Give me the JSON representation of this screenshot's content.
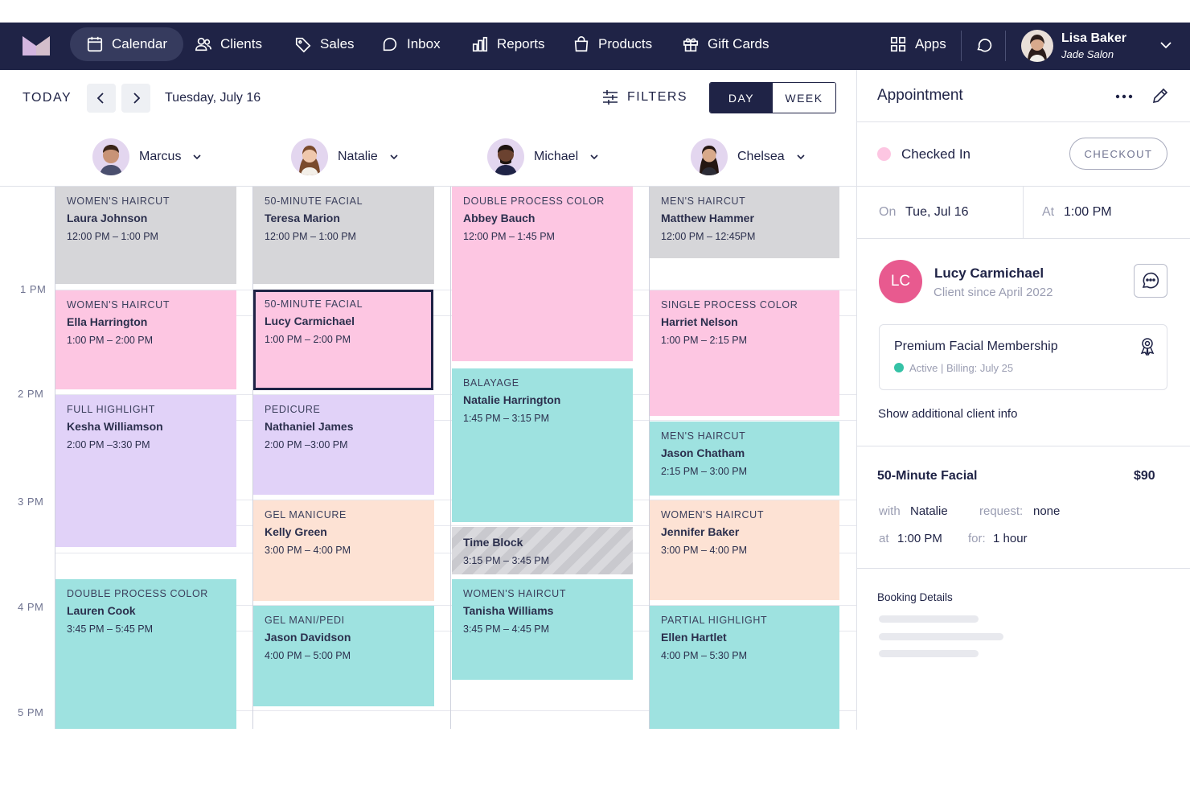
{
  "nav": {
    "items": [
      {
        "label": "Calendar",
        "icon": "calendar-icon"
      },
      {
        "label": "Clients",
        "icon": "clients-icon"
      },
      {
        "label": "Sales",
        "icon": "tag-icon"
      },
      {
        "label": "Inbox",
        "icon": "inbox-icon"
      },
      {
        "label": "Reports",
        "icon": "reports-icon"
      },
      {
        "label": "Products",
        "icon": "bag-icon"
      },
      {
        "label": "Gift Cards",
        "icon": "gift-icon"
      }
    ],
    "apps_label": "Apps",
    "user": {
      "name": "Lisa Baker",
      "salon": "Jade Salon"
    }
  },
  "toolbar": {
    "today_label": "TODAY",
    "date_label": "Tuesday, July 16",
    "filters_label": "FILTERS",
    "view_day": "DAY",
    "view_week": "WEEK"
  },
  "staff": [
    {
      "name": "Marcus"
    },
    {
      "name": "Natalie"
    },
    {
      "name": "Michael"
    },
    {
      "name": "Chelsea"
    }
  ],
  "time_labels": [
    "1 PM",
    "2 PM",
    "3 PM",
    "4 PM",
    "5 PM"
  ],
  "columns": [
    [
      {
        "service": "WOMEN'S HAIRCUT",
        "client": "Laura Johnson",
        "time": "12:00 PM – 1:00 PM",
        "color": "gray"
      },
      {
        "service": "WOMEN'S HAIRCUT",
        "client": "Ella Harrington",
        "time": "1:00 PM – 2:00 PM",
        "color": "pink"
      },
      {
        "service": "FULL HIGHLIGHT",
        "client": "Kesha Williamson",
        "time": "2:00 PM –3:30 PM",
        "color": "purple"
      },
      {
        "service": "DOUBLE PROCESS COLOR",
        "client": "Lauren Cook",
        "time": "3:45 PM – 5:45 PM",
        "color": "teal"
      }
    ],
    [
      {
        "service": "50-MINUTE FACIAL",
        "client": "Teresa Marion",
        "time": "12:00 PM – 1:00 PM",
        "color": "gray"
      },
      {
        "service": "50-MINUTE FACIAL",
        "client": "Lucy Carmichael",
        "time": "1:00 PM – 2:00 PM",
        "color": "pink",
        "selected": true
      },
      {
        "service": "PEDICURE",
        "client": "Nathaniel James",
        "time": "2:00 PM –3:00 PM",
        "color": "purple"
      },
      {
        "service": "GEL MANICURE",
        "client": "Kelly Green",
        "time": "3:00 PM – 4:00 PM",
        "color": "peach"
      },
      {
        "service": "GEL MANI/PEDI",
        "client": "Jason Davidson",
        "time": "4:00 PM – 5:00 PM",
        "color": "teal"
      }
    ],
    [
      {
        "service": "DOUBLE PROCESS COLOR",
        "client": "Abbey Bauch",
        "time": "12:00 PM – 1:45 PM",
        "color": "pink"
      },
      {
        "service": "BALAYAGE",
        "client": "Natalie Harrington",
        "time": "1:45 PM – 3:15 PM",
        "color": "teal"
      },
      {
        "service": "",
        "client": "Time Block",
        "time": "3:15 PM – 3:45 PM",
        "color": "block"
      },
      {
        "service": "WOMEN'S HAIRCUT",
        "client": "Tanisha Williams",
        "time": "3:45 PM – 4:45 PM",
        "color": "teal"
      }
    ],
    [
      {
        "service": "MEN'S HAIRCUT",
        "client": "Matthew Hammer",
        "time": "12:00 PM – 12:45PM",
        "color": "gray"
      },
      {
        "service": "SINGLE PROCESS COLOR",
        "client": "Harriet Nelson",
        "time": "1:00 PM – 2:15 PM",
        "color": "pink"
      },
      {
        "service": "MEN'S HAIRCUT",
        "client": "Jason Chatham",
        "time": "2:15 PM – 3:00 PM",
        "color": "teal"
      },
      {
        "service": "WOMEN'S HAIRCUT",
        "client": "Jennifer Baker",
        "time": "3:00 PM – 4:00 PM",
        "color": "peach"
      },
      {
        "service": "PARTIAL HIGHLIGHT",
        "client": "Ellen Hartlet",
        "time": "4:00 PM – 5:30 PM",
        "color": "teal"
      }
    ]
  ],
  "panel": {
    "title": "Appointment",
    "status": "Checked In",
    "checkout_label": "CHECKOUT",
    "on_label": "On",
    "on_value": "Tue, Jul 16",
    "at_label": "At",
    "at_value": "1:00 PM",
    "client_initials": "LC",
    "client_name": "Lucy Carmichael",
    "client_since": "Client since April 2022",
    "membership_title": "Premium Facial Membership",
    "membership_status": "Active  |  Billing: July 25",
    "show_more": "Show additional client info",
    "service_name": "50-Minute Facial",
    "service_price": "$90",
    "with_label": "with",
    "with_value": "Natalie",
    "request_label": "request:",
    "request_value": "none",
    "at2_label": "at",
    "at2_value": "1:00 PM",
    "for_label": "for:",
    "for_value": "1 hour",
    "booking_title": "Booking Details"
  },
  "colors": {
    "nav_bg": "#1f2346",
    "gray": "#d6d6d9",
    "pink": "#fdc6e2",
    "purple": "#e1d2f8",
    "teal": "#9ee2e0",
    "peach": "#fde2d4",
    "avatar_lc": "#e85a8f",
    "active_dot": "#35c2a6"
  }
}
